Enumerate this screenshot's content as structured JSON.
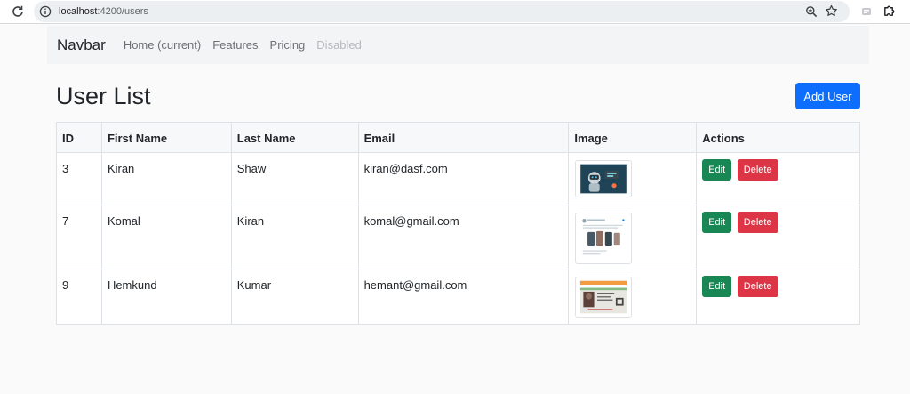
{
  "browser": {
    "url_host": "localhost",
    "url_path": ":4200/users"
  },
  "navbar": {
    "brand": "Navbar",
    "links": [
      {
        "label": "Home (current)"
      },
      {
        "label": "Features"
      },
      {
        "label": "Pricing"
      },
      {
        "label": "Disabled"
      }
    ]
  },
  "page": {
    "title": "User List",
    "add_button": "Add User"
  },
  "table": {
    "headers": [
      "ID",
      "First Name",
      "Last Name",
      "Email",
      "Image",
      "Actions"
    ],
    "rows": [
      {
        "id": "3",
        "first": "Kiran",
        "last": "Shaw",
        "email": "kiran@dasf.com"
      },
      {
        "id": "7",
        "first": "Komal",
        "last": "Kiran",
        "email": "komal@gmail.com"
      },
      {
        "id": "9",
        "first": "Hemkund",
        "last": "Kumar",
        "email": "hemant@gmail.com"
      }
    ],
    "edit_label": "Edit",
    "delete_label": "Delete"
  },
  "colors": {
    "primary": "#0d6efd",
    "success": "#198754",
    "danger": "#dc3545"
  }
}
